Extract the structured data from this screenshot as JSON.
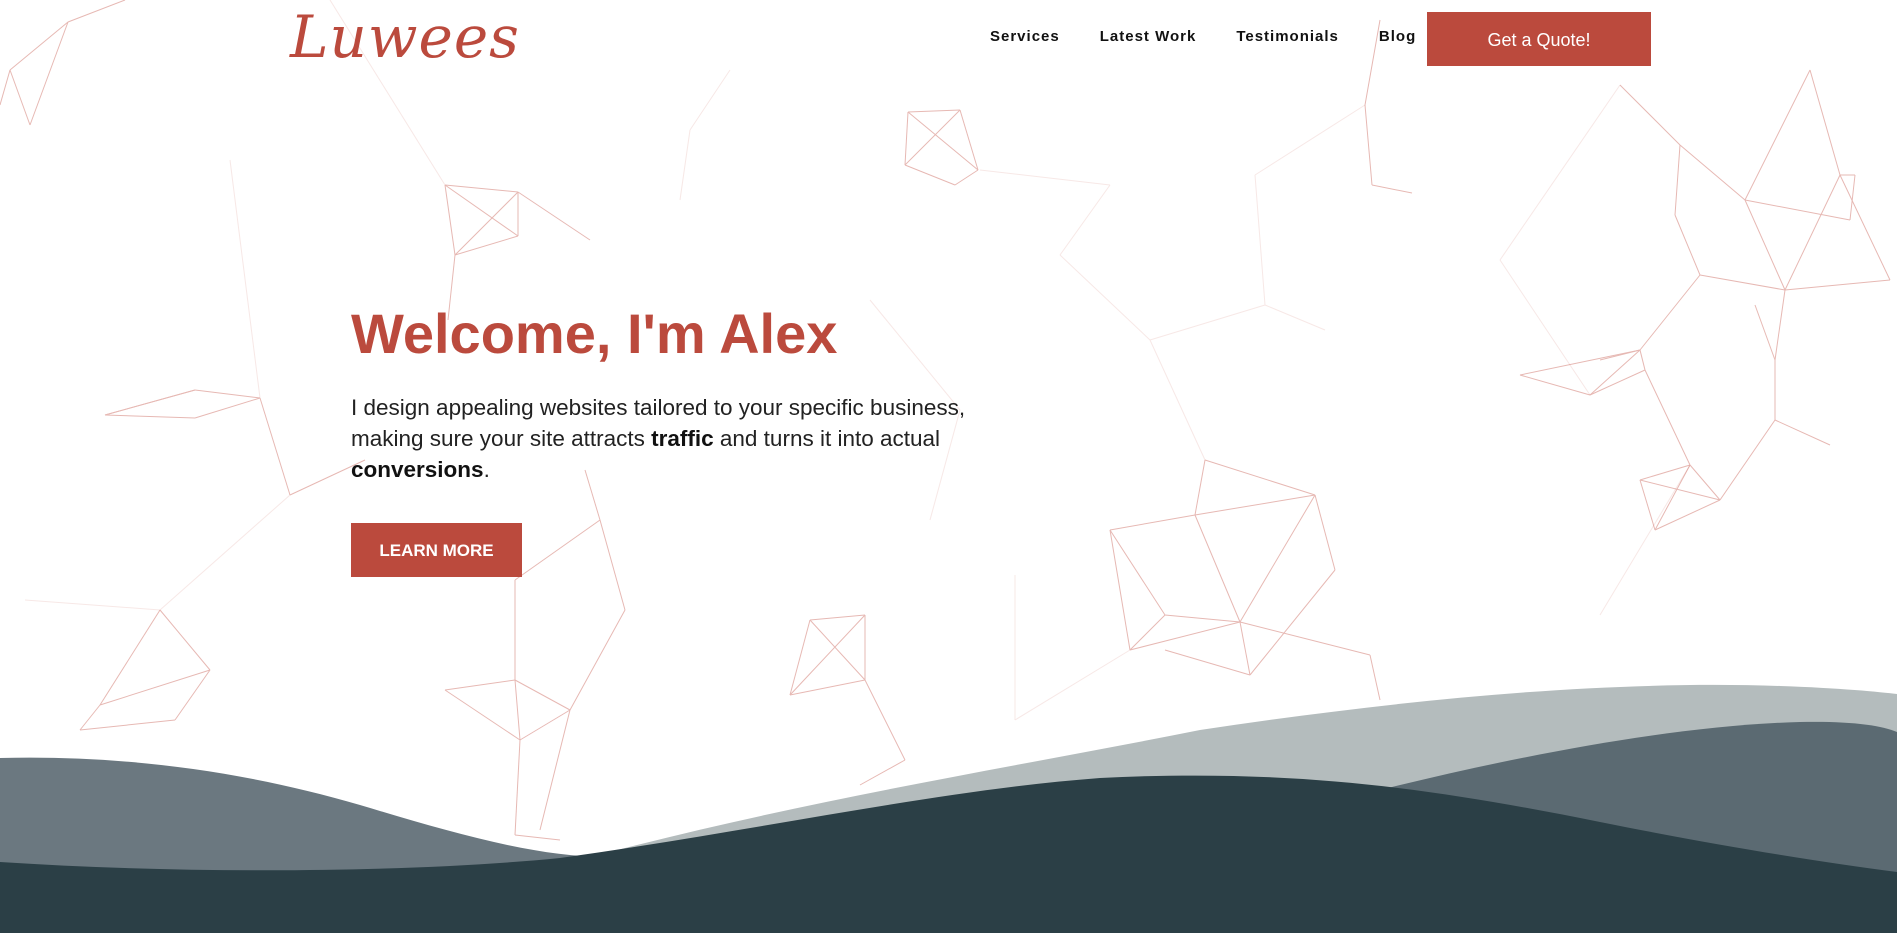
{
  "header": {
    "logo_text": "Luwees",
    "nav": {
      "services": "Services",
      "latest_work": "Latest Work",
      "testimonials": "Testimonials",
      "blog": "Blog"
    },
    "quote_button": "Get a Quote!"
  },
  "hero": {
    "title": "Welcome, I'm Alex",
    "text_part1": "I design appealing websites tailored to your specific business, making sure your site attracts ",
    "text_bold1": "traffic",
    "text_part2": " and turns it into actual ",
    "text_bold2": "conversions",
    "text_part3": ".",
    "button": "LEARN MORE"
  },
  "colors": {
    "accent": "#bb4a3d",
    "wave_light": "#b4bcbd",
    "wave_mid": "#5b6a72",
    "wave_dark": "#2b3f46",
    "wave_left": "#6b7880"
  }
}
